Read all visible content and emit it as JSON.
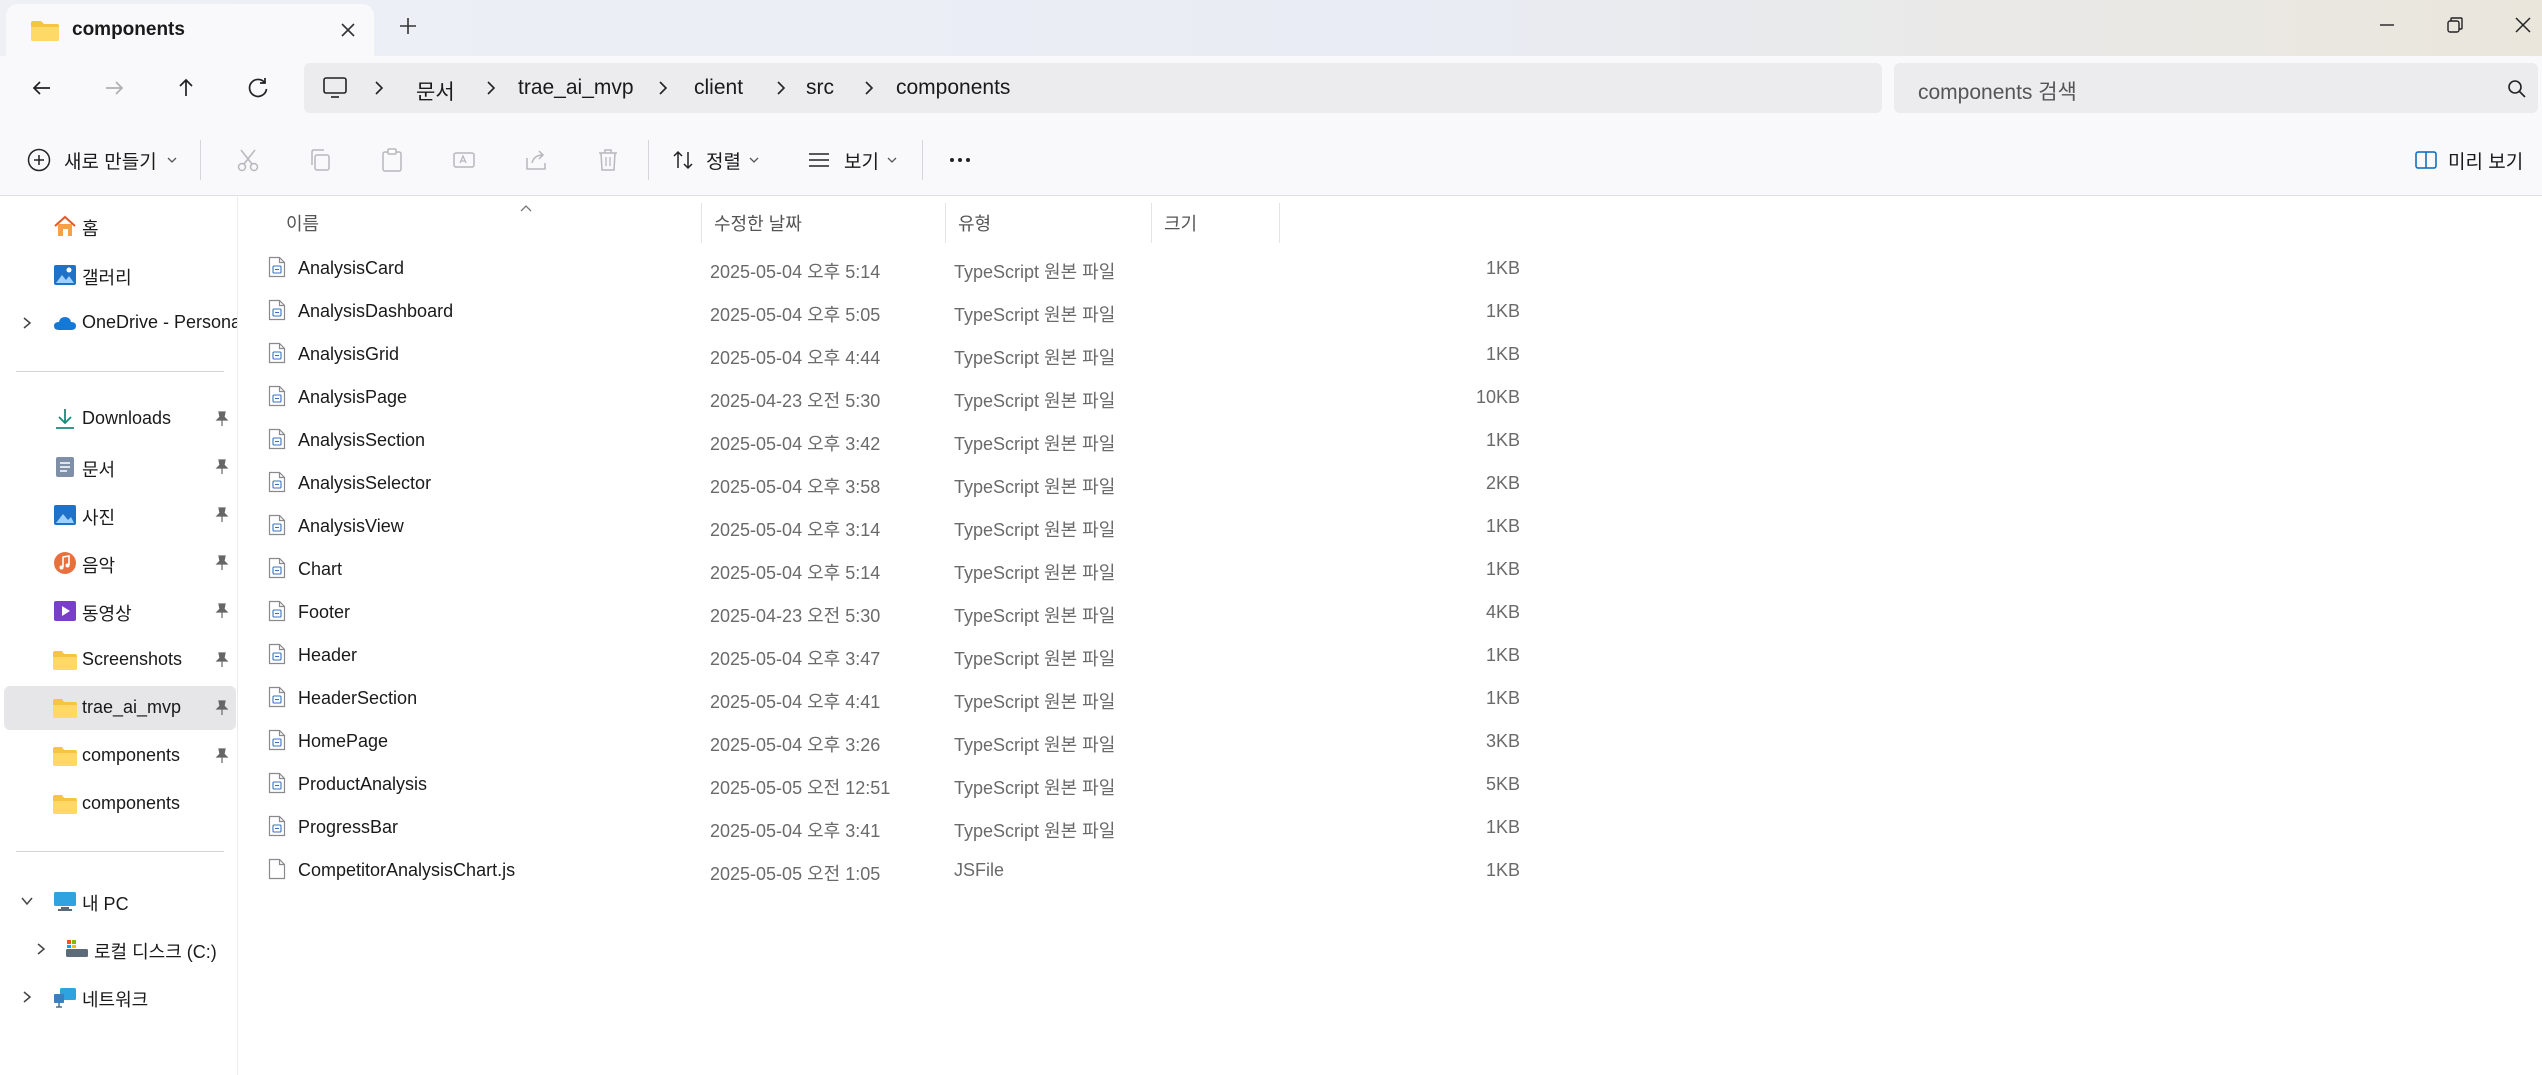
{
  "tab": {
    "title": "components"
  },
  "address": {
    "crumbs": [
      "문서",
      "trae_ai_mvp",
      "client",
      "src",
      "components"
    ]
  },
  "search": {
    "placeholder": "components 검색"
  },
  "toolbar": {
    "new_label": "새로 만들기",
    "sort_label": "정렬",
    "view_label": "보기",
    "preview_label": "미리 보기"
  },
  "sidebar": {
    "home": "홈",
    "gallery": "갤러리",
    "onedrive": "OneDrive - Persona",
    "quick": [
      {
        "label": "Downloads"
      },
      {
        "label": "문서"
      },
      {
        "label": "사진"
      },
      {
        "label": "음악"
      },
      {
        "label": "동영상"
      },
      {
        "label": "Screenshots"
      },
      {
        "label": "trae_ai_mvp"
      },
      {
        "label": "components"
      },
      {
        "label": "components"
      }
    ],
    "this_pc": "내 PC",
    "local_disk": "로컬 디스크 (C:)",
    "network": "네트워크"
  },
  "columns": {
    "name": "이름",
    "modified": "수정한 날짜",
    "type": "유형",
    "size": "크기"
  },
  "files": [
    {
      "name": "AnalysisCard",
      "date": "2025-05-04 오후 5:14",
      "type": "TypeScript 원본 파일",
      "size": "1KB"
    },
    {
      "name": "AnalysisDashboard",
      "date": "2025-05-04 오후 5:05",
      "type": "TypeScript 원본 파일",
      "size": "1KB"
    },
    {
      "name": "AnalysisGrid",
      "date": "2025-05-04 오후 4:44",
      "type": "TypeScript 원본 파일",
      "size": "1KB"
    },
    {
      "name": "AnalysisPage",
      "date": "2025-04-23 오전 5:30",
      "type": "TypeScript 원본 파일",
      "size": "10KB"
    },
    {
      "name": "AnalysisSection",
      "date": "2025-05-04 오후 3:42",
      "type": "TypeScript 원본 파일",
      "size": "1KB"
    },
    {
      "name": "AnalysisSelector",
      "date": "2025-05-04 오후 3:58",
      "type": "TypeScript 원본 파일",
      "size": "2KB"
    },
    {
      "name": "AnalysisView",
      "date": "2025-05-04 오후 3:14",
      "type": "TypeScript 원본 파일",
      "size": "1KB"
    },
    {
      "name": "Chart",
      "date": "2025-05-04 오후 5:14",
      "type": "TypeScript 원본 파일",
      "size": "1KB"
    },
    {
      "name": "Footer",
      "date": "2025-04-23 오전 5:30",
      "type": "TypeScript 원본 파일",
      "size": "4KB"
    },
    {
      "name": "Header",
      "date": "2025-05-04 오후 3:47",
      "type": "TypeScript 원본 파일",
      "size": "1KB"
    },
    {
      "name": "HeaderSection",
      "date": "2025-05-04 오후 4:41",
      "type": "TypeScript 원본 파일",
      "size": "1KB"
    },
    {
      "name": "HomePage",
      "date": "2025-05-04 오후 3:26",
      "type": "TypeScript 원본 파일",
      "size": "3KB"
    },
    {
      "name": "ProductAnalysis",
      "date": "2025-05-05 오전 12:51",
      "type": "TypeScript 원본 파일",
      "size": "5KB"
    },
    {
      "name": "ProgressBar",
      "date": "2025-05-04 오후 3:41",
      "type": "TypeScript 원본 파일",
      "size": "1KB"
    },
    {
      "name": "CompetitorAnalysisChart.js",
      "date": "2025-05-05 오전 1:05",
      "type": "JSFile",
      "size": "1KB"
    }
  ],
  "colors": {
    "accent": "#0067c0",
    "folder": "#f5c542",
    "selected_bg": "#e6e6e9"
  }
}
